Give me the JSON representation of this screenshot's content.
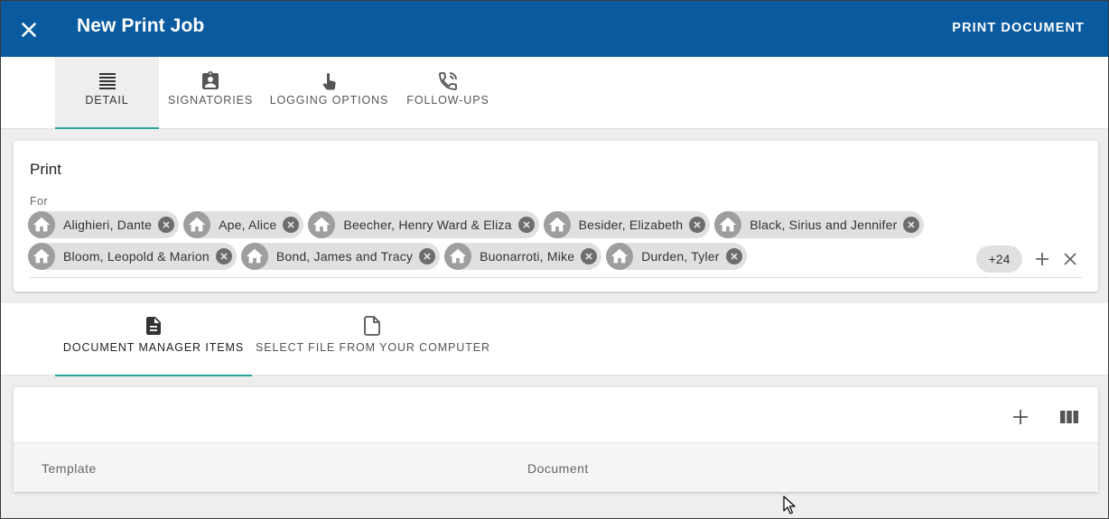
{
  "header": {
    "title": "New Print Job",
    "close_icon": "close-icon",
    "action_label": "PRINT DOCUMENT",
    "bg_color": "#0a5aa0"
  },
  "tabs": [
    {
      "label": "DETAIL",
      "icon": "list-icon",
      "active": true
    },
    {
      "label": "SIGNATORIES",
      "icon": "clipboard-account-icon",
      "active": false
    },
    {
      "label": "LOGGING OPTIONS",
      "icon": "touch-icon",
      "active": false
    },
    {
      "label": "FOLLOW-UPS",
      "icon": "phone-icon",
      "active": false
    }
  ],
  "print_card": {
    "title": "Print",
    "for_label": "For",
    "chips_row1": [
      "Alighieri, Dante",
      "Ape, Alice",
      "Beecher, Henry Ward & Eliza",
      "Besider, Elizabeth",
      "Black, Sirius and Jennifer"
    ],
    "chips_row2": [
      "Bloom, Leopold & Marion",
      "Bond, James and Tracy",
      "Buonarroti, Mike",
      "Durden, Tyler"
    ],
    "more_count": "+24"
  },
  "source_tabs": [
    {
      "label": "DOCUMENT MANAGER ITEMS",
      "icon": "document-icon",
      "active": true
    },
    {
      "label": "SELECT FILE FROM YOUR COMPUTER",
      "icon": "file-outline-icon",
      "active": false
    }
  ],
  "table": {
    "columns": [
      "Template",
      "Document"
    ]
  },
  "accent_color": "#26a69a"
}
